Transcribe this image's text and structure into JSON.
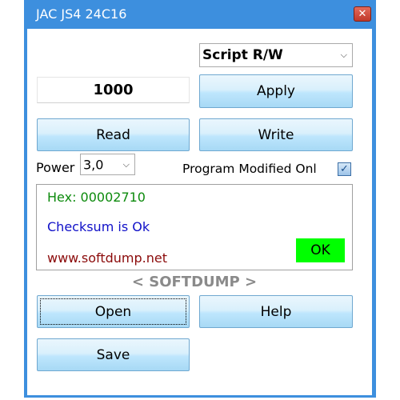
{
  "window": {
    "title": "JAC JS4 24C16",
    "close_glyph": "✕"
  },
  "mode_select": {
    "value": "Script R/W",
    "chevron": "⌵"
  },
  "value_input": {
    "value": "1000"
  },
  "buttons": {
    "apply": "Apply",
    "read": "Read",
    "write": "Write",
    "open": "Open",
    "help": "Help",
    "save": "Save"
  },
  "power": {
    "label": "Power",
    "value": "3,0",
    "chevron": "⌵"
  },
  "program_modified": {
    "label": "Program Modified Onl",
    "checked_glyph": "✓"
  },
  "status_panel": {
    "hex": "Hex: 00002710",
    "checksum": "Checksum is Ok",
    "website": "www.softdump.net",
    "ok_label": "OK",
    "hex_color": "#0c8a0c",
    "checksum_color": "#1010c8",
    "website_color": "#8b0a0a",
    "ok_bg": "#00ff00"
  },
  "brand": "< SOFTDUMP >",
  "colors": {
    "titlebar": "#3d8fde",
    "close": "#c0392b"
  }
}
